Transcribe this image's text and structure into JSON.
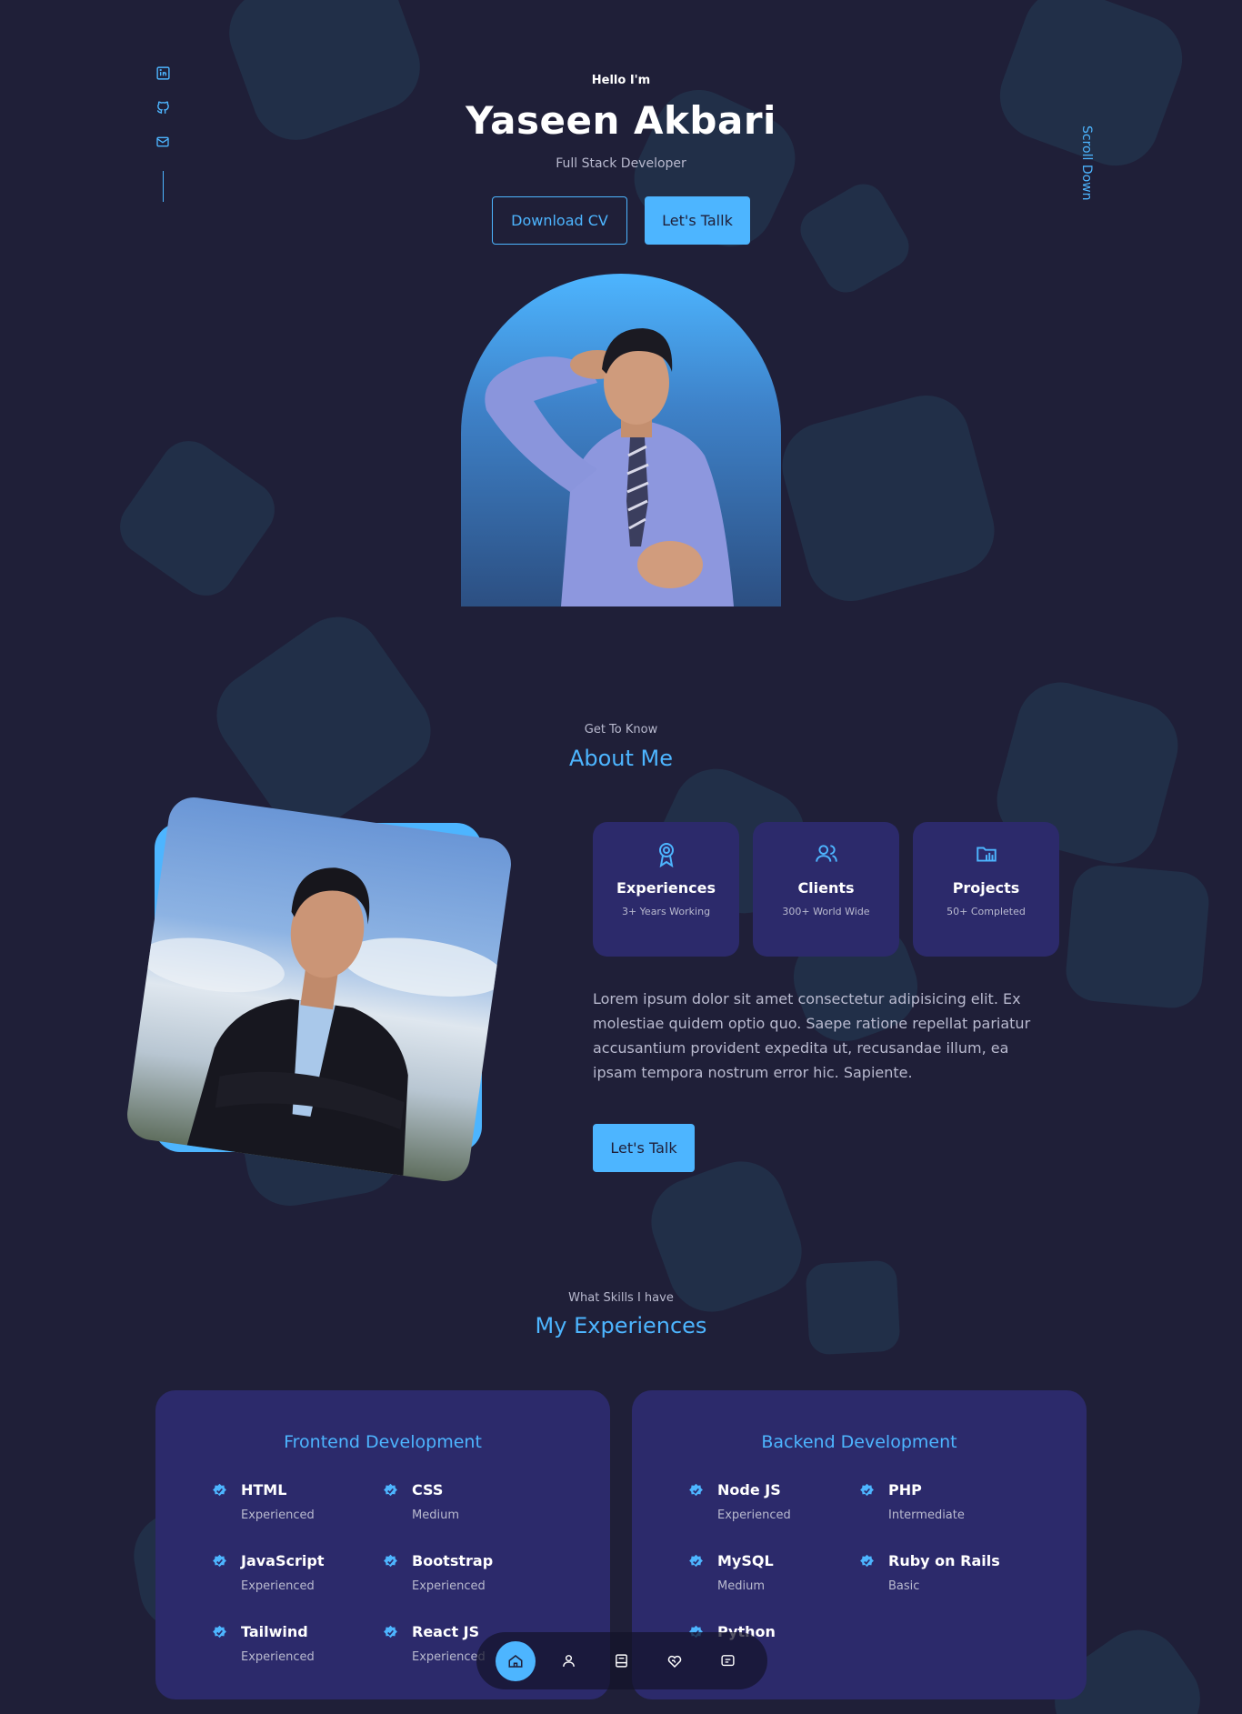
{
  "header": {
    "greeting": "Hello I'm",
    "name": "Yaseen Akbari",
    "role": "Full Stack Developer",
    "download_cv_label": "Download CV",
    "lets_talk_label": "Let's Tallk",
    "scroll_down_label": "Scroll Down",
    "socials": [
      "linkedin-icon",
      "github-icon",
      "mail-icon"
    ]
  },
  "about": {
    "small_heading": "Get To Know",
    "heading": "About Me",
    "cards": [
      {
        "icon": "award-icon",
        "title": "Experiences",
        "subtitle": "3+ Years Working"
      },
      {
        "icon": "users-icon",
        "title": "Clients",
        "subtitle": "300+ World Wide"
      },
      {
        "icon": "folder-icon",
        "title": "Projects",
        "subtitle": "50+ Completed"
      }
    ],
    "paragraph": "Lorem ipsum dolor sit amet consectetur adipisicing elit. Ex molestiae quidem optio quo. Saepe ratione repellat pariatur accusantium provident expedita ut, recusandae illum, ea ipsam tempora nostrum error hic. Sapiente.",
    "cta_label": "Let's Talk"
  },
  "experience": {
    "small_heading": "What Skills I have",
    "heading": "My Experiences",
    "frontend": {
      "title": "Frontend Development",
      "skills": [
        {
          "name": "HTML",
          "level": "Experienced"
        },
        {
          "name": "CSS",
          "level": "Medium"
        },
        {
          "name": "JavaScript",
          "level": "Experienced"
        },
        {
          "name": "Bootstrap",
          "level": "Experienced"
        },
        {
          "name": "Tailwind",
          "level": "Experienced"
        },
        {
          "name": "React JS",
          "level": "Experienced"
        }
      ]
    },
    "backend": {
      "title": "Backend Development",
      "skills": [
        {
          "name": "Node JS",
          "level": "Experienced"
        },
        {
          "name": "PHP",
          "level": "Intermediate"
        },
        {
          "name": "MySQL",
          "level": "Medium"
        },
        {
          "name": "Ruby on Rails",
          "level": "Basic"
        },
        {
          "name": "Python",
          "level": ""
        }
      ]
    }
  },
  "nav": {
    "items": [
      "home-icon",
      "user-icon",
      "book-icon",
      "services-icon",
      "message-icon"
    ],
    "active": "home-icon"
  },
  "colors": {
    "background": "#1f1f38",
    "accent": "#4db5ff",
    "card": "#2c2a6b",
    "muted_text": "#b9bacf"
  }
}
